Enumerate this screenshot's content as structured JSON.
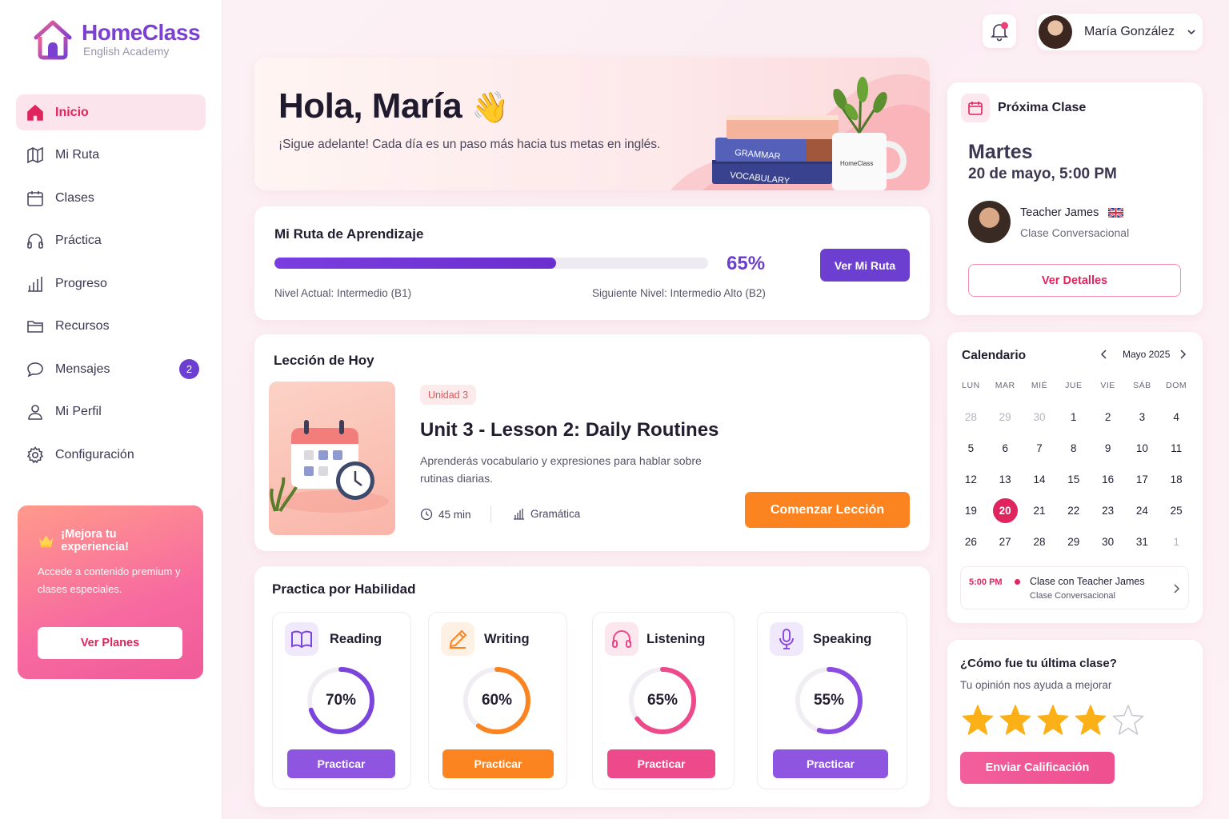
{
  "brand": {
    "title": "HomeClass",
    "subtitle": "English Academy"
  },
  "sidebar": {
    "items": [
      {
        "label": "Inicio",
        "icon": "home-icon",
        "active": true
      },
      {
        "label": "Mi Ruta",
        "icon": "map-icon"
      },
      {
        "label": "Clases",
        "icon": "calendar-icon"
      },
      {
        "label": "Práctica",
        "icon": "headphones-icon"
      },
      {
        "label": "Progreso",
        "icon": "bar-chart-icon"
      },
      {
        "label": "Recursos",
        "icon": "folder-icon"
      },
      {
        "label": "Mensajes",
        "icon": "chat-icon",
        "badge": "2"
      },
      {
        "label": "Mi Perfil",
        "icon": "user-icon"
      },
      {
        "label": "Configuración",
        "icon": "gear-icon"
      }
    ],
    "promo": {
      "title": "¡Mejora tu experiencia!",
      "text": "Accede a contenido premium y clases especiales.",
      "button": "Ver Planes"
    }
  },
  "topbar": {
    "user_name": "María González"
  },
  "hero": {
    "greeting": "Hola, María",
    "emoji": "👋",
    "subtitle": "¡Sigue adelante! Cada día es un paso más hacia tus metas en inglés.",
    "book1": "GRAMMAR",
    "book2": "VOCABULARY",
    "mug": "HomeClass"
  },
  "route": {
    "title": "Mi Ruta de Aprendizaje",
    "progress": 65,
    "progress_label": "65%",
    "current_level": "Nivel Actual: Intermedio (B1)",
    "next_level": "Siguiente Nivel: Intermedio Alto (B2)",
    "button": "Ver Mi Ruta"
  },
  "lesson": {
    "section_title": "Lección de Hoy",
    "unit": "Unidad 3",
    "title": "Unit 3 - Lesson 2: Daily Routines",
    "description": "Aprenderás vocabulario y expresiones para hablar sobre rutinas diarias.",
    "duration": "45 min",
    "category": "Gramática",
    "button": "Comenzar Lección"
  },
  "skills": {
    "title": "Practica por Habilidad",
    "items": [
      {
        "name": "Reading",
        "percent": 70,
        "label": "70%",
        "button": "Practicar",
        "color": "#7b45dc"
      },
      {
        "name": "Writing",
        "percent": 60,
        "label": "60%",
        "button": "Practicar",
        "color": "#fb8420"
      },
      {
        "name": "Listening",
        "percent": 65,
        "label": "65%",
        "button": "Practicar",
        "color": "#ec4a8a"
      },
      {
        "name": "Speaking",
        "percent": 55,
        "label": "55%",
        "button": "Practicar",
        "color": "#8a4de0"
      }
    ]
  },
  "next_class": {
    "title": "Próxima Clase",
    "day": "Martes",
    "datetime": "20 de mayo, 5:00 PM",
    "teacher": "Teacher James",
    "type": "Clase Conversacional",
    "button": "Ver Detalles"
  },
  "calendar": {
    "title": "Calendario",
    "month": "Mayo 2025",
    "weekdays": [
      "LUN",
      "MAR",
      "MIÉ",
      "JUE",
      "VIE",
      "SÁB",
      "DOM"
    ],
    "weeks": [
      [
        "28",
        "29",
        "30",
        "1",
        "2",
        "3",
        "4"
      ],
      [
        "5",
        "6",
        "7",
        "8",
        "9",
        "10",
        "11"
      ],
      [
        "12",
        "13",
        "14",
        "15",
        "16",
        "17",
        "18"
      ],
      [
        "19",
        "20",
        "21",
        "22",
        "23",
        "24",
        "25"
      ],
      [
        "26",
        "27",
        "28",
        "29",
        "30",
        "31",
        "1"
      ]
    ],
    "today": "20",
    "event": {
      "time": "5:00 PM",
      "title": "Clase con Teacher James",
      "type": "Clase Conversacional"
    }
  },
  "feedback": {
    "question": "¿Cómo fue tu última clase?",
    "subtitle": "Tu opinión nos ayuda a mejorar",
    "rating": 4,
    "max_rating": 5,
    "button": "Enviar Calificación"
  }
}
